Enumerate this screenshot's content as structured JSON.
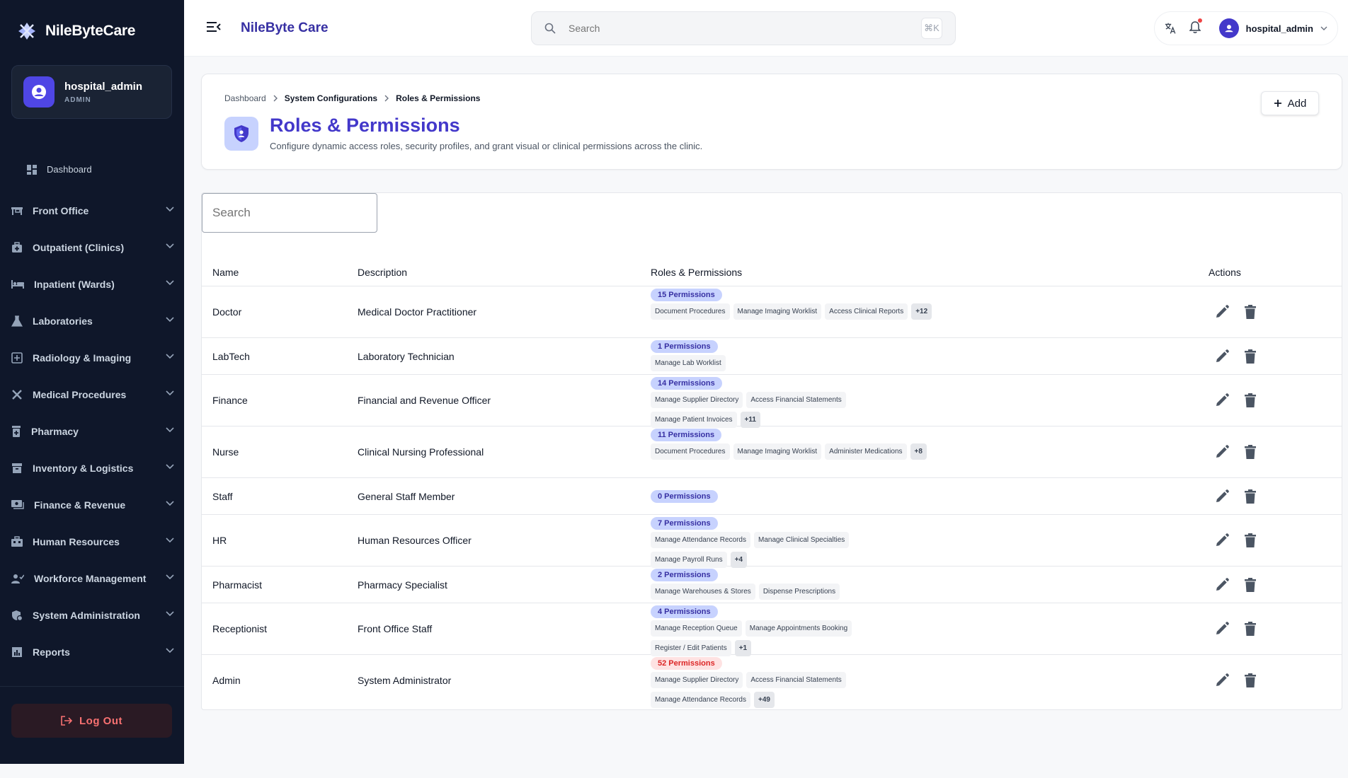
{
  "brand": {
    "name": "NileByteCare"
  },
  "sidebar_user": {
    "name": "hospital_admin",
    "role": "ADMIN"
  },
  "sidebar": {
    "dashboard_label": "Dashboard",
    "items": [
      {
        "label": "Front Office",
        "icon": "front-desk-icon"
      },
      {
        "label": "Outpatient (Clinics)",
        "icon": "medical-bag-icon"
      },
      {
        "label": "Inpatient (Wards)",
        "icon": "bed-icon"
      },
      {
        "label": "Laboratories",
        "icon": "flask-icon"
      },
      {
        "label": "Radiology & Imaging",
        "icon": "scan-icon"
      },
      {
        "label": "Medical Procedures",
        "icon": "tools-icon"
      },
      {
        "label": "Pharmacy",
        "icon": "pill-bottle-icon"
      },
      {
        "label": "Inventory & Logistics",
        "icon": "inventory-icon"
      },
      {
        "label": "Finance & Revenue",
        "icon": "money-icon"
      },
      {
        "label": "Human Resources",
        "icon": "briefcase-icon"
      },
      {
        "label": "Workforce Management",
        "icon": "people-icon"
      },
      {
        "label": "System Administration",
        "icon": "admin-shield-icon"
      },
      {
        "label": "Reports",
        "icon": "chart-icon"
      }
    ],
    "logout_label": "Log Out"
  },
  "topbar": {
    "title": "NileByte Care",
    "search_placeholder": "Search",
    "shortcut": "⌘K",
    "username": "hospital_admin"
  },
  "header": {
    "breadcrumb": {
      "home": "Dashboard",
      "parent": "System Configurations",
      "current": "Roles & Permissions"
    },
    "title": "Roles & Permissions",
    "subtitle": "Configure dynamic access roles, security profiles, and grant visual or clinical permissions across the clinic.",
    "add_label": "Add"
  },
  "table": {
    "search_placeholder": "Search",
    "columns": {
      "name": "Name",
      "description": "Description",
      "permissions": "Roles & Permissions",
      "actions": "Actions"
    },
    "rows": [
      {
        "name": "Doctor",
        "description": "Medical Doctor Practitioner",
        "badge": "15 Permissions",
        "chips": [
          "Document Procedures",
          "Manage Imaging Worklist",
          "Access Clinical Reports"
        ],
        "more": "+12"
      },
      {
        "name": "LabTech",
        "description": "Laboratory Technician",
        "badge": "1 Permissions",
        "chips": [
          "Manage Lab Worklist"
        ],
        "more": ""
      },
      {
        "name": "Finance",
        "description": "Financial and Revenue Officer",
        "badge": "14 Permissions",
        "chips": [
          "Manage Supplier Directory",
          "Access Financial Statements",
          "Manage Patient Invoices"
        ],
        "more": "+11"
      },
      {
        "name": "Nurse",
        "description": "Clinical Nursing Professional",
        "badge": "11 Permissions",
        "chips": [
          "Document Procedures",
          "Manage Imaging Worklist",
          "Administer Medications"
        ],
        "more": "+8"
      },
      {
        "name": "Staff",
        "description": "General Staff Member",
        "badge": "0 Permissions",
        "chips": [],
        "more": ""
      },
      {
        "name": "HR",
        "description": "Human Resources Officer",
        "badge": "7 Permissions",
        "chips": [
          "Manage Attendance Records",
          "Manage Clinical Specialties",
          "Manage Payroll Runs"
        ],
        "more": "+4"
      },
      {
        "name": "Pharmacist",
        "description": "Pharmacy Specialist",
        "badge": "2 Permissions",
        "chips": [
          "Manage Warehouses & Stores",
          "Dispense Prescriptions"
        ],
        "more": ""
      },
      {
        "name": "Receptionist",
        "description": "Front Office Staff",
        "badge": "4 Permissions",
        "chips": [
          "Manage Reception Queue",
          "Manage Appointments Booking",
          "Register / Edit Patients"
        ],
        "more": "+1"
      },
      {
        "name": "Admin",
        "description": "System Administrator",
        "badge": "52 Permissions",
        "badge_variant": "danger",
        "chips": [
          "Manage Supplier Directory",
          "Access Financial Statements",
          "Manage Attendance Records"
        ],
        "more": "+49"
      }
    ]
  },
  "colors": {
    "sidebar_bg": "#0f172a",
    "accent": "#4338ca",
    "badge_bg": "#c7d2fe",
    "danger": "#dc2626"
  }
}
